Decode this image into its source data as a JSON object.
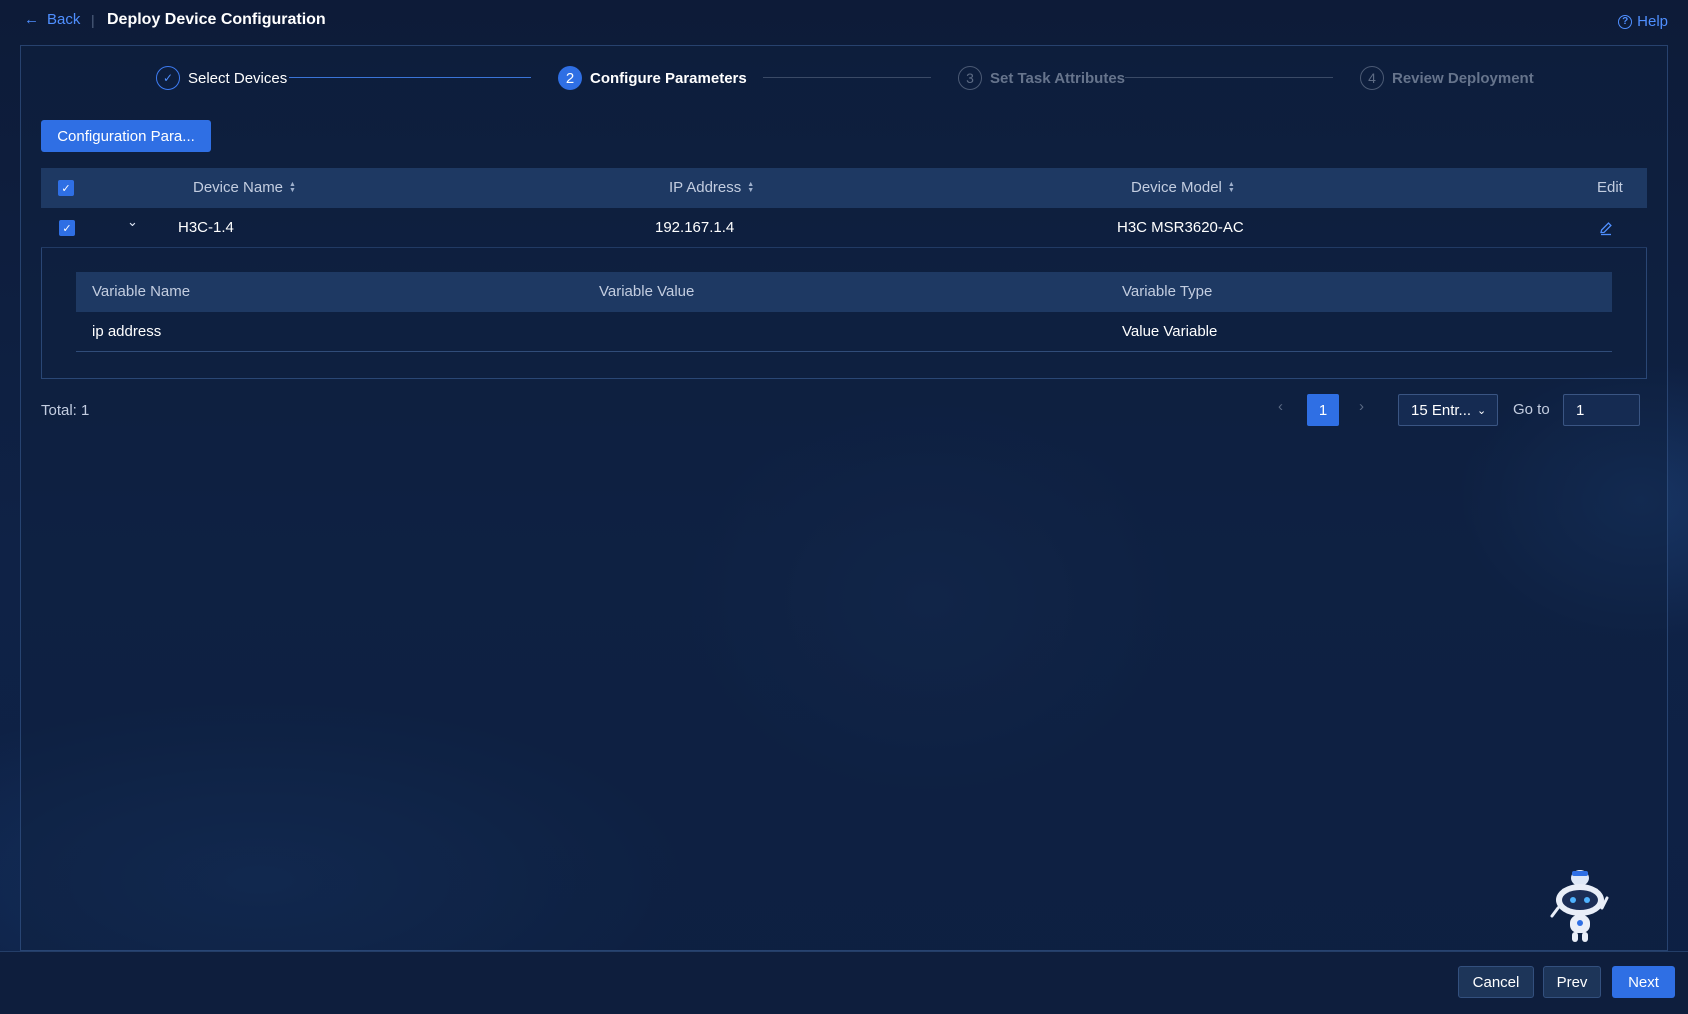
{
  "header": {
    "back_label": "Back",
    "title": "Deploy Device Configuration",
    "help_label": "Help"
  },
  "steps": [
    {
      "number": "✓",
      "label": "Select Devices",
      "state": "done"
    },
    {
      "number": "2",
      "label": "Configure Parameters",
      "state": "active"
    },
    {
      "number": "3",
      "label": "Set Task Attributes",
      "state": "todo"
    },
    {
      "number": "4",
      "label": "Review Deployment",
      "state": "todo"
    }
  ],
  "toolbar": {
    "config_button_label": "Configuration Para..."
  },
  "table": {
    "columns": {
      "device_name": "Device Name",
      "ip_address": "IP Address",
      "device_model": "Device Model",
      "edit": "Edit"
    },
    "rows": [
      {
        "device_name": "H3C-1.4",
        "ip_address": "192.167.1.4",
        "device_model": "H3C MSR3620-AC",
        "checked": true
      }
    ],
    "subtable": {
      "columns": {
        "variable_name": "Variable Name",
        "variable_value": "Variable Value",
        "variable_type": "Variable Type"
      },
      "rows": [
        {
          "variable_name": "ip address",
          "variable_value": "",
          "variable_type": "Value Variable"
        }
      ]
    }
  },
  "pagination": {
    "total_label": "Total: 1",
    "current_page": "1",
    "page_size": "15 Entr...",
    "goto_label": "Go to",
    "goto_value": "1"
  },
  "footer": {
    "cancel_label": "Cancel",
    "prev_label": "Prev",
    "next_label": "Next"
  },
  "colors": {
    "accent": "#2f6fe4",
    "link": "#4f8fff",
    "background": "#0f2246"
  }
}
